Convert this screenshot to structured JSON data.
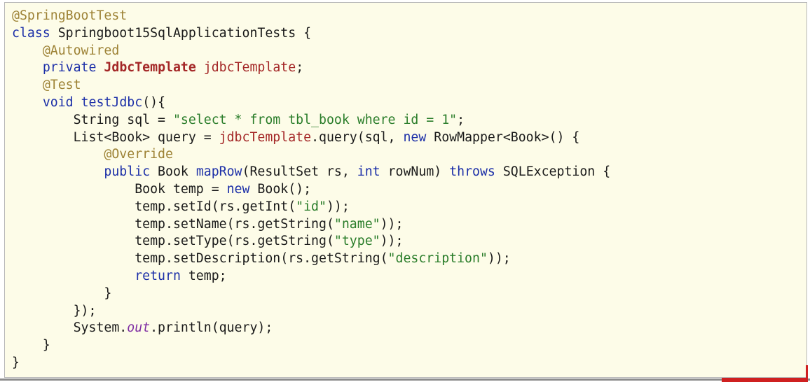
{
  "colors": {
    "panel_background": "#fdfce8",
    "keyword": "#1c2fa8",
    "annotation": "#9d8235",
    "string": "#2a7d2a",
    "type_highlight": "#a42727",
    "static_field": "#7f2da3",
    "accent_red": "#cf2020"
  },
  "code": {
    "lines": [
      [
        {
          "t": "@SpringBootTest",
          "k": "ann"
        }
      ],
      [
        {
          "t": "class",
          "k": "kw"
        },
        {
          "t": " Springboot15SqlApplicationTests {",
          "k": "plain"
        }
      ],
      [
        {
          "t": "    ",
          "k": "plain"
        },
        {
          "t": "@Autowired",
          "k": "ann"
        }
      ],
      [
        {
          "t": "    ",
          "k": "plain"
        },
        {
          "t": "private",
          "k": "kw"
        },
        {
          "t": " ",
          "k": "plain"
        },
        {
          "t": "JdbcTemplate",
          "k": "type"
        },
        {
          "t": " ",
          "k": "plain"
        },
        {
          "t": "jdbcTemplate",
          "k": "field"
        },
        {
          "t": ";",
          "k": "plain"
        }
      ],
      [
        {
          "t": "    ",
          "k": "plain"
        },
        {
          "t": "@Test",
          "k": "ann"
        }
      ],
      [
        {
          "t": "    ",
          "k": "plain"
        },
        {
          "t": "void",
          "k": "kw"
        },
        {
          "t": " ",
          "k": "plain"
        },
        {
          "t": "testJdbc",
          "k": "method"
        },
        {
          "t": "(){",
          "k": "plain"
        }
      ],
      [
        {
          "t": "        String sql = ",
          "k": "plain"
        },
        {
          "t": "\"select * from tbl_book where id = 1\"",
          "k": "str"
        },
        {
          "t": ";",
          "k": "plain"
        }
      ],
      [
        {
          "t": "        List<Book> query = ",
          "k": "plain"
        },
        {
          "t": "jdbcTemplate",
          "k": "field"
        },
        {
          "t": ".query(sql, ",
          "k": "plain"
        },
        {
          "t": "new",
          "k": "kw"
        },
        {
          "t": " RowMapper<Book>() {",
          "k": "plain"
        }
      ],
      [
        {
          "t": "            ",
          "k": "plain"
        },
        {
          "t": "@Override",
          "k": "ann"
        }
      ],
      [
        {
          "t": "            ",
          "k": "plain"
        },
        {
          "t": "public",
          "k": "kw"
        },
        {
          "t": " Book ",
          "k": "plain"
        },
        {
          "t": "mapRow",
          "k": "method"
        },
        {
          "t": "(ResultSet rs, ",
          "k": "plain"
        },
        {
          "t": "int",
          "k": "kw"
        },
        {
          "t": " rowNum) ",
          "k": "plain"
        },
        {
          "t": "throws",
          "k": "kw"
        },
        {
          "t": " SQLException {",
          "k": "plain"
        }
      ],
      [
        {
          "t": "                Book temp = ",
          "k": "plain"
        },
        {
          "t": "new",
          "k": "kw"
        },
        {
          "t": " Book();",
          "k": "plain"
        }
      ],
      [
        {
          "t": "                temp.setId(rs.getInt(",
          "k": "plain"
        },
        {
          "t": "\"id\"",
          "k": "str"
        },
        {
          "t": "));",
          "k": "plain"
        }
      ],
      [
        {
          "t": "                temp.setName(rs.getString(",
          "k": "plain"
        },
        {
          "t": "\"name\"",
          "k": "str"
        },
        {
          "t": "));",
          "k": "plain"
        }
      ],
      [
        {
          "t": "                temp.setType(rs.getString(",
          "k": "plain"
        },
        {
          "t": "\"type\"",
          "k": "str"
        },
        {
          "t": "));",
          "k": "plain"
        }
      ],
      [
        {
          "t": "                temp.setDescription(rs.getString(",
          "k": "plain"
        },
        {
          "t": "\"description\"",
          "k": "str"
        },
        {
          "t": "));",
          "k": "plain"
        }
      ],
      [
        {
          "t": "                ",
          "k": "plain"
        },
        {
          "t": "return",
          "k": "kw"
        },
        {
          "t": " temp;",
          "k": "plain"
        }
      ],
      [
        {
          "t": "            }",
          "k": "plain"
        }
      ],
      [
        {
          "t": "        });",
          "k": "plain"
        }
      ],
      [
        {
          "t": "        System.",
          "k": "plain"
        },
        {
          "t": "out",
          "k": "static"
        },
        {
          "t": ".println(query);",
          "k": "plain"
        }
      ],
      [
        {
          "t": "    }",
          "k": "plain"
        }
      ],
      [
        {
          "t": "}",
          "k": "plain"
        }
      ]
    ]
  }
}
